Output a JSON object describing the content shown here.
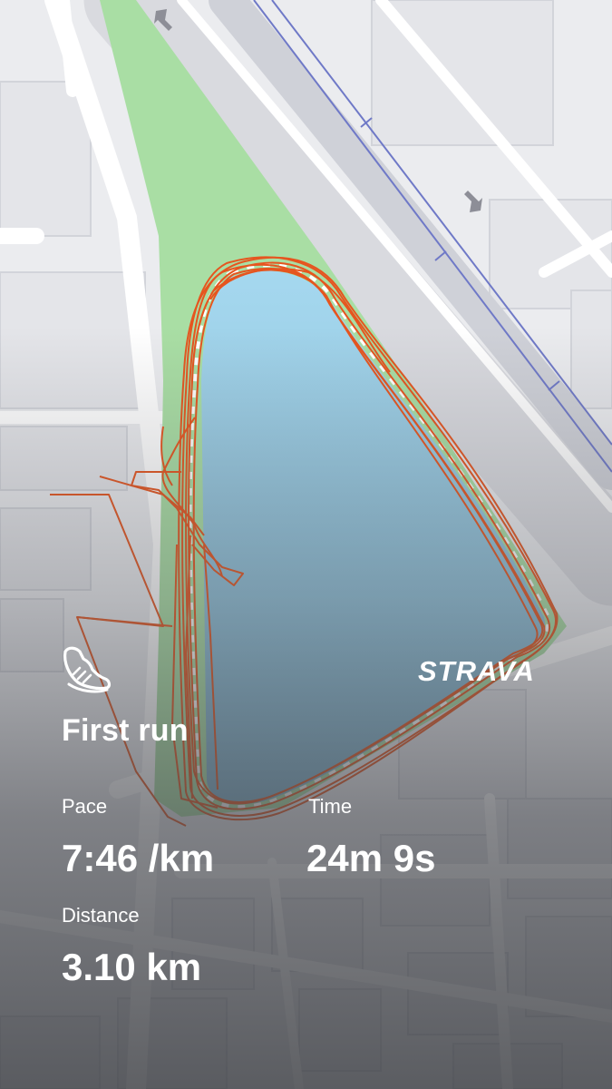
{
  "activity": {
    "title": "First run",
    "icon": "running-shoe-icon"
  },
  "stats": {
    "pace_label": "Pace",
    "pace_value": "7:46 /km",
    "time_label": "Time",
    "time_value": "24m 9s",
    "distance_label": "Distance",
    "distance_value": "3.10 km"
  },
  "brand": {
    "logo_text": "STRAVA"
  },
  "colors": {
    "route": "#e6551f",
    "water": "#9fd2ea",
    "park": "#a9dea4",
    "road": "#d5d6dc",
    "text": "#ffffff"
  }
}
